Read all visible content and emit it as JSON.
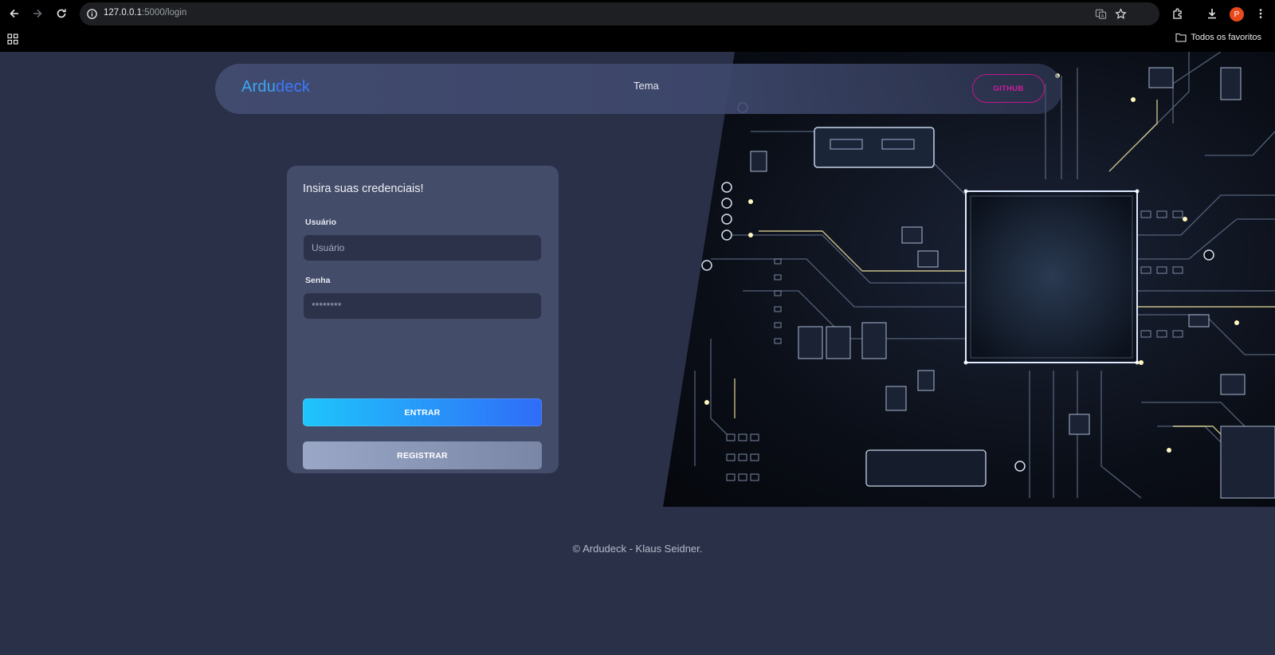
{
  "browser": {
    "url_host": "127.0.0.1",
    "url_path": ":5000/login",
    "profile_initial": "P",
    "bookmarks_folder_label": "Todos os favoritos"
  },
  "navbar": {
    "brand_part1": "Ardu",
    "brand_part2": "deck",
    "theme_link": "Tema",
    "github_button": "GITHUB"
  },
  "login": {
    "title": "Insira suas credenciais!",
    "username_label": "Usuário",
    "username_placeholder": "Usuário",
    "password_label": "Senha",
    "password_placeholder": "********",
    "login_button": "ENTRAR",
    "register_button": "REGISTRAR"
  },
  "footer": {
    "text": "© Ardudeck - Klaus Seidner."
  },
  "colors": {
    "page_bg": "#2a3048",
    "card_bg": "#434c69",
    "accent_blue": "#2f6cf8",
    "accent_cyan": "#1fc5fb",
    "github_pink": "#d01c9e"
  }
}
